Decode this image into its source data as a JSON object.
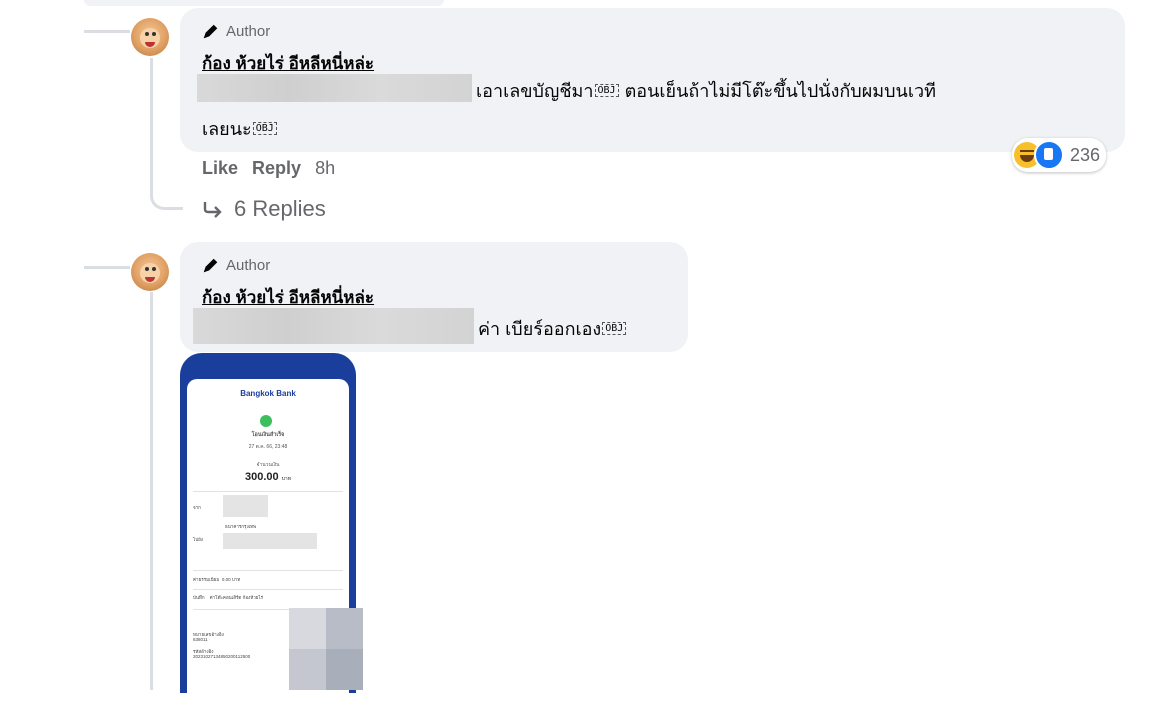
{
  "comment1": {
    "badge": "Author",
    "name": "ก้อง ห้วยไร่ อีหลีหนี่หล่ะ",
    "line1": "เอาเลขบัญชีมา",
    "line1b": " ตอนเย็นถ้าไม่มีโต๊ะขึ้นไปนั่งกับผมบนเวที",
    "line2": "เลยนะ",
    "obj": "OBJ",
    "like": "Like",
    "reply": "Reply",
    "time": "8h",
    "reaction_count": "236",
    "replies_label": "6 Replies"
  },
  "comment2": {
    "badge": "Author",
    "name": "ก้อง ห้วยไร่ อีหลีหนี่หล่ะ",
    "text": "ค่า เบียร์ออกเอง",
    "obj": "OBJ"
  },
  "slip": {
    "bank": "Bangkok Bank",
    "status": "โอนเงินสำเร็จ",
    "date": "27 ต.ค. 66, 23:48",
    "amount_label": "จำนวนเงิน",
    "amount": "300.00",
    "currency": "บาท",
    "from_label": "จาก",
    "from_bank": "ธนาคารกรุงเทพ",
    "to_label": "ไปยัง",
    "fee_label": "ค่าธรรมเนียม",
    "fee_value": "0.00 บาท",
    "memo_label": "บันทึก",
    "memo_value": "ค่าโต๊ะคอนเสิร์ต ก้องห้วยไร่",
    "ref_label": "หมายเลขอ้างอิง",
    "ref_value": "638011",
    "txn_label": "รหัสอ้างอิง",
    "txn_value": "20231027134850200112500"
  },
  "colors": {
    "bubble": "#f0f2f5",
    "secondary_text": "#65676b",
    "like_blue": "#1877f2",
    "slip_header": "#1a3e9c"
  }
}
